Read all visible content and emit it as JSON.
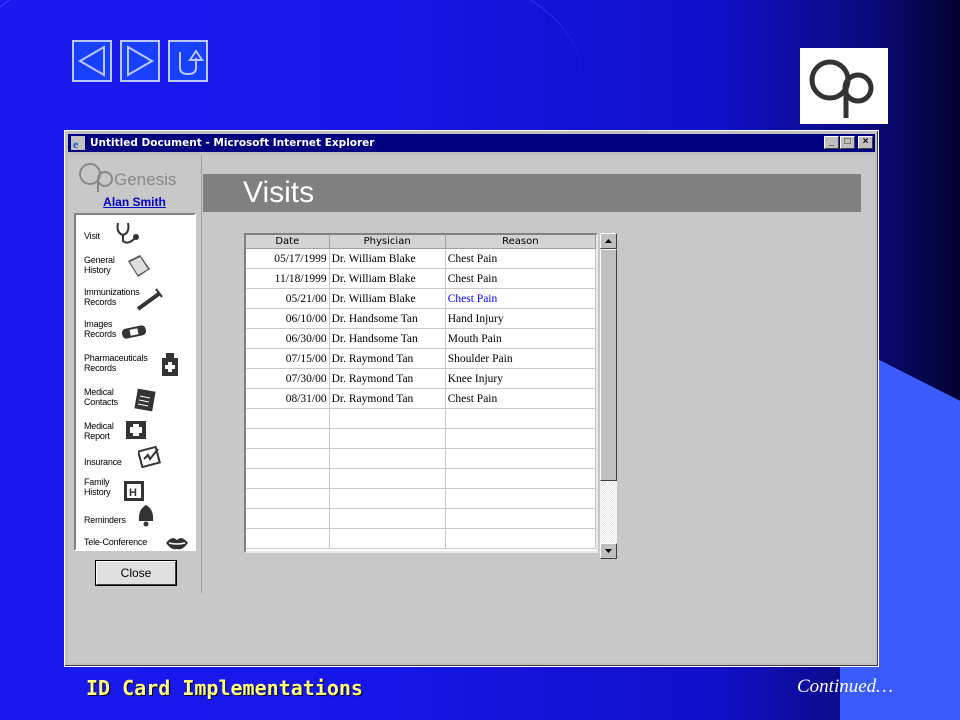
{
  "slide": {
    "footer_title": "ID Card Implementations",
    "footer_continued": "Continued…",
    "logo_text": "Op"
  },
  "nav": {
    "back_icon": "triangle-left-icon",
    "forward_icon": "triangle-right-icon",
    "return_icon": "u-turn-icon"
  },
  "window": {
    "title": "Untitled Document - Microsoft Internet Explorer",
    "minimize": "_",
    "maximize": "□",
    "close": "×"
  },
  "app": {
    "brand": "OpGenesis",
    "patient_name": "Alan Smith",
    "page_heading": "Visits",
    "close_label": "Close",
    "menu": [
      {
        "label": "Visit",
        "icon": "stethoscope-icon"
      },
      {
        "label": "General\nHistory",
        "icon": "book-icon"
      },
      {
        "label": "Immunizations\nRecords",
        "icon": "syringe-icon"
      },
      {
        "label": "Images\nRecords",
        "icon": "bandage-icon"
      },
      {
        "label": "Pharmaceuticals\nRecords",
        "icon": "medicine-bottle-icon"
      },
      {
        "label": "Medical\nContacts",
        "icon": "clipboard-icon"
      },
      {
        "label": "Medical\nReport",
        "icon": "medical-kit-icon"
      },
      {
        "label": "Insurance",
        "icon": "signed-document-icon"
      },
      {
        "label": "Family\nHistory",
        "icon": "family-photo-icon"
      },
      {
        "label": "Reminders",
        "icon": "bell-icon"
      },
      {
        "label": "Tele-Conference",
        "icon": "lips-icon"
      }
    ]
  },
  "visits_table": {
    "headers": [
      "Date",
      "Physician",
      "Reason"
    ],
    "rows": [
      {
        "date": "05/17/1999",
        "physician": "Dr. William Blake",
        "reason": "Chest Pain",
        "highlight": false
      },
      {
        "date": "11/18/1999",
        "physician": "Dr. William Blake",
        "reason": "Chest Pain",
        "highlight": false
      },
      {
        "date": "05/21/00",
        "physician": "Dr. William Blake",
        "reason": "Chest Pain",
        "highlight": true
      },
      {
        "date": "06/10/00",
        "physician": "Dr. Handsome Tan",
        "reason": "Hand Injury",
        "highlight": false
      },
      {
        "date": "06/30/00",
        "physician": "Dr. Handsome Tan",
        "reason": "Mouth Pain",
        "highlight": false
      },
      {
        "date": "07/15/00",
        "physician": "Dr. Raymond Tan",
        "reason": "Shoulder Pain",
        "highlight": false
      },
      {
        "date": "07/30/00",
        "physician": "Dr. Raymond Tan",
        "reason": "Knee Injury",
        "highlight": false
      },
      {
        "date": "08/31/00",
        "physician": "Dr. Raymond Tan",
        "reason": "Chest Pain",
        "highlight": false
      }
    ],
    "empty_rows": 7
  },
  "colors": {
    "slide_blue": "#1a1af0",
    "titlebar": "#000080",
    "highlight_text": "#0000ff",
    "footer_title": "#ffff80"
  }
}
